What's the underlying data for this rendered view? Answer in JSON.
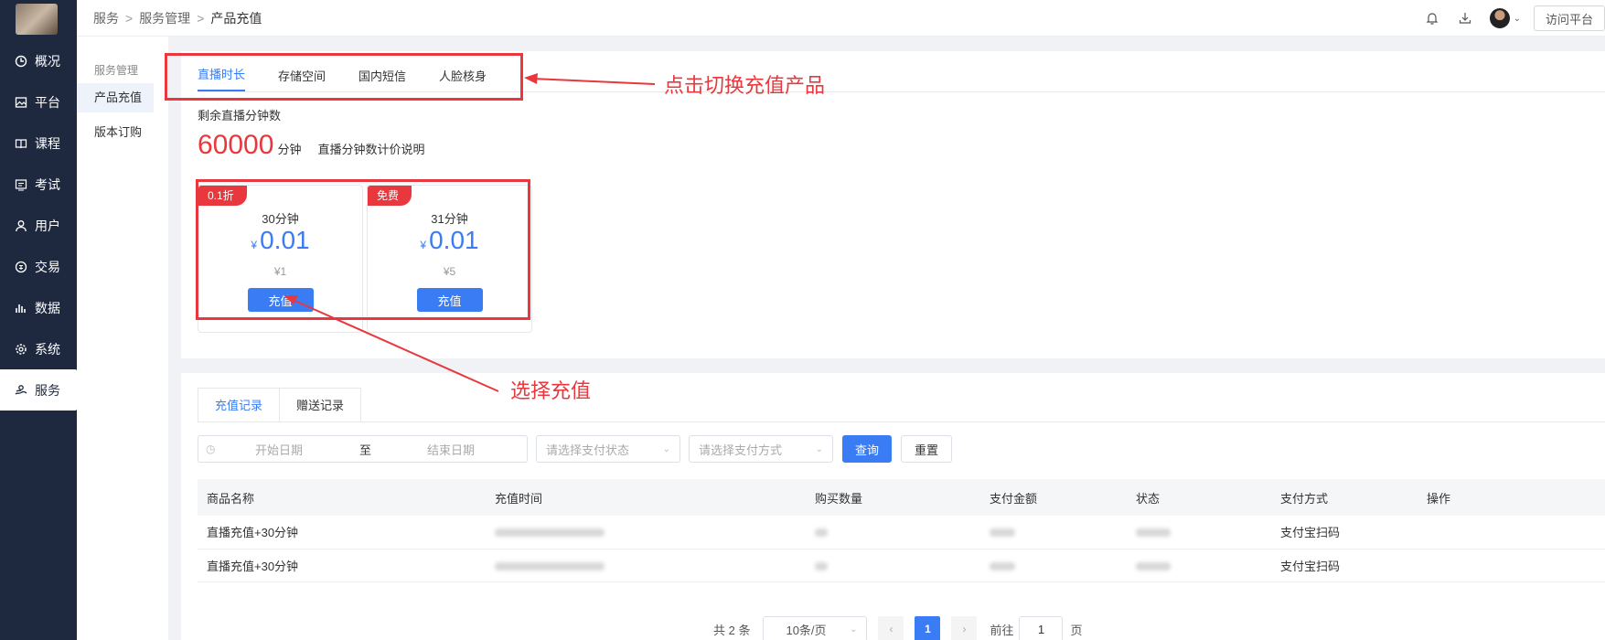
{
  "sidebar": {
    "items": [
      {
        "label": "概况",
        "icon": "clock-icon"
      },
      {
        "label": "平台",
        "icon": "image-icon"
      },
      {
        "label": "课程",
        "icon": "book-icon"
      },
      {
        "label": "考试",
        "icon": "exam-icon"
      },
      {
        "label": "用户",
        "icon": "user-icon"
      },
      {
        "label": "交易",
        "icon": "exchange-icon"
      },
      {
        "label": "数据",
        "icon": "bar-chart-icon"
      },
      {
        "label": "系统",
        "icon": "gear-icon"
      },
      {
        "label": "服务",
        "icon": "service-icon",
        "active": true
      }
    ]
  },
  "breadcrumb": [
    "服务",
    "服务管理",
    "产品充值"
  ],
  "header": {
    "visit_label": "访问平台"
  },
  "subnav": {
    "group": "服务管理",
    "items": [
      "产品充值",
      "版本订购"
    ]
  },
  "product_tabs": [
    "直播时长",
    "存储空间",
    "国内短信",
    "人脸核身"
  ],
  "remaining": {
    "label": "剩余直播分钟数",
    "value": "60000",
    "unit": "分钟",
    "pricing_link": "直播分钟数计价说明"
  },
  "cards": [
    {
      "badge": "0.1折",
      "name": "30分钟",
      "currency": "¥",
      "price": "0.01",
      "original": "¥1",
      "button": "充值"
    },
    {
      "badge": "免费",
      "name": "31分钟",
      "currency": "¥",
      "price": "0.01",
      "original": "¥5",
      "button": "充值"
    }
  ],
  "record_tabs": [
    "充值记录",
    "赠送记录"
  ],
  "filters": {
    "start_placeholder": "开始日期",
    "to": "至",
    "end_placeholder": "结束日期",
    "status_placeholder": "请选择支付状态",
    "method_placeholder": "请选择支付方式",
    "query": "查询",
    "reset": "重置"
  },
  "table": {
    "columns": [
      "商品名称",
      "充值时间",
      "购买数量",
      "支付金额",
      "状态",
      "支付方式",
      "操作"
    ],
    "rows": [
      {
        "name": "直播充值+30分钟",
        "method": "支付宝扫码"
      },
      {
        "name": "直播充值+30分钟",
        "method": "支付宝扫码"
      }
    ]
  },
  "pagination": {
    "total": "共 2 条",
    "page_size": "10条/页",
    "current": "1",
    "goto": "前往",
    "goto_value": "1",
    "page_unit": "页"
  },
  "annotations": {
    "switch_product": "点击切换充值产品",
    "choose_recharge": "选择充值"
  },
  "colors": {
    "sidebar_bg": "#1e2940",
    "primary": "#3a7cf4",
    "accent_red": "#e8383d"
  }
}
